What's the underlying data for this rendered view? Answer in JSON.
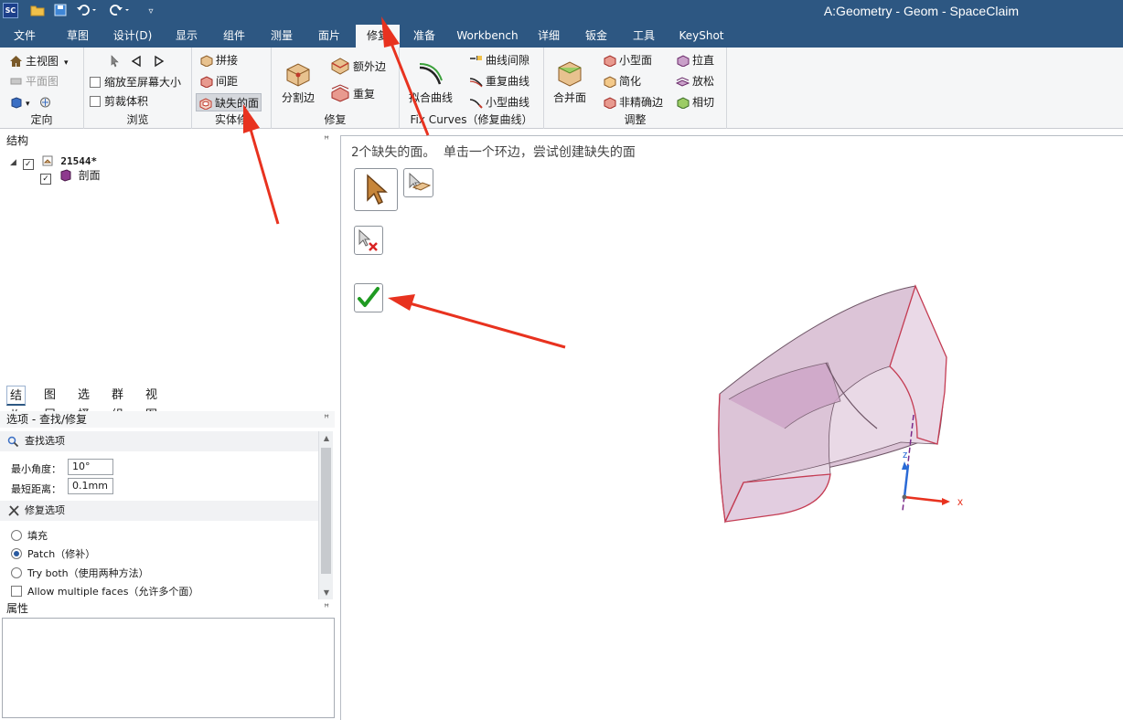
{
  "app": {
    "title": "A:Geometry - Geom - SpaceClaim",
    "logo_text": "SC"
  },
  "menu": {
    "items": [
      "文件",
      "草图",
      "设计(D)",
      "显示",
      "组件",
      "测量",
      "面片",
      "修复",
      "准备",
      "Workbench",
      "详细",
      "钣金",
      "工具",
      "KeyShot"
    ],
    "active": "修复"
  },
  "ribbon": {
    "orient": {
      "label": "定向",
      "main_view": "主视图",
      "plan_view": "平面图"
    },
    "browse": {
      "label": "浏览",
      "zoom_fit": "缩放至屏幕大小",
      "clip_volume": "剪裁体积"
    },
    "solids": {
      "label": "实体修",
      "stitch": "拼接",
      "gap": "间距",
      "missing_faces": "缺失的面"
    },
    "repair": {
      "label": "修复",
      "split_edges": "分割边",
      "extra_edges": "额外边",
      "duplicates": "重复"
    },
    "fix_curves": {
      "label": "Fix Curves（修复曲线）",
      "fit_curves": "拟合曲线",
      "curve_gaps": "曲线间隙",
      "duplicate_curves": "重复曲线",
      "small_curves": "小型曲线"
    },
    "adjust": {
      "label": "调整",
      "merge_faces": "合并面",
      "small_faces": "小型面",
      "simplify": "简化",
      "inexact_edges": "非精确边",
      "straighten": "拉直",
      "relax": "放松",
      "tangency": "相切"
    }
  },
  "structure": {
    "title": "结构",
    "root": "21544*",
    "child": "剖面"
  },
  "panel_tabs": [
    "结构",
    "图层",
    "选择",
    "群组",
    "视图"
  ],
  "options": {
    "title": "选项 - 查找/修复",
    "find_section": "查找选项",
    "min_angle_label": "最小角度：",
    "min_angle_value": "10°",
    "max_distance_label": "最短距离：",
    "max_distance_value": "0.1mm",
    "fix_section": "修复选项",
    "radios": [
      "填充",
      "Patch（修补）",
      "Try both（使用两种方法）"
    ],
    "selected_radio": 1,
    "allow_multiple": "Allow multiple faces（允许多个面）"
  },
  "properties": {
    "title": "属性"
  },
  "viewport": {
    "hint": "2个缺失的面。 单击一个环边，尝试创建缺失的面",
    "triad": {
      "x": "x",
      "z": "z"
    }
  },
  "colors": {
    "titlebar": "#2d5782",
    "annotation_red": "#e8321f",
    "model_fill": "#d9b8d3",
    "model_edge_red": "#d23c4e"
  }
}
